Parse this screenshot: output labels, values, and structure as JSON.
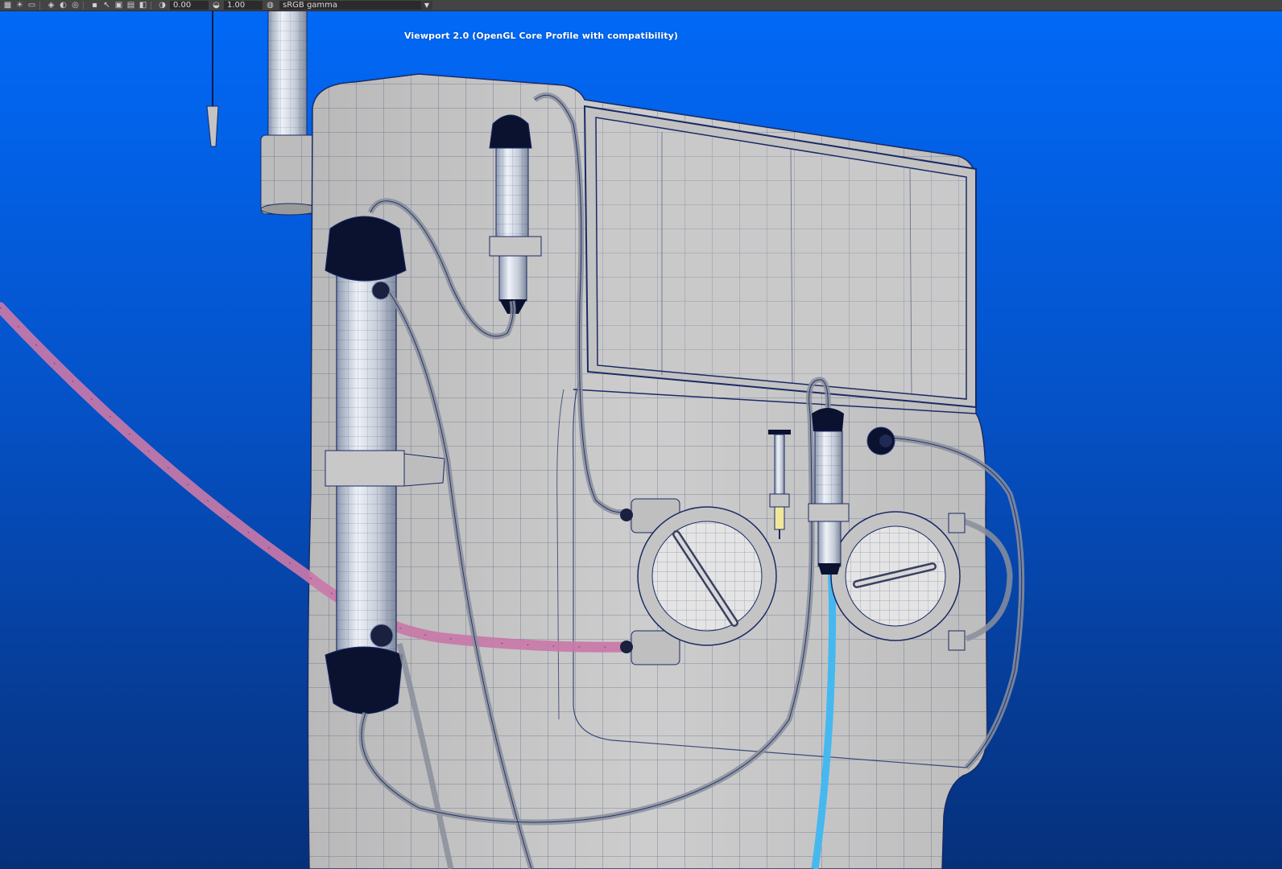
{
  "toolbar": {
    "icons": [
      "checker-icon",
      "bulb-icon",
      "render-region-icon",
      "layers-icon",
      "paint-icon",
      "isolate-icon",
      "select-icon",
      "snap-icon",
      "pin-icon",
      "frame-icon",
      "camera-icon",
      "exposure-icon",
      "gamma-icon",
      "colorspace-icon"
    ],
    "exposure_value": "0.00",
    "gamma_value": "1.00",
    "color_space": "sRGB gamma"
  },
  "viewport": {
    "renderer_label": "Viewport 2.0 (OpenGL Core Profile with compatibility)",
    "background_top": "#0169f7",
    "background_bottom": "#06307a",
    "model_color": "#c9c9c9",
    "wire_color": "#1a2a66"
  }
}
